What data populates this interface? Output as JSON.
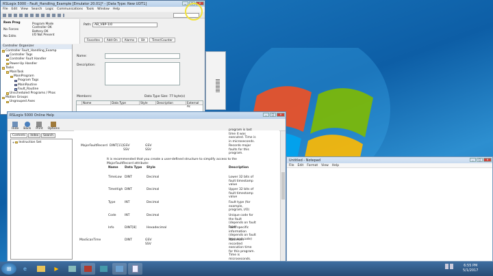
{
  "rslogix": {
    "title": "RSLogix 5000 - Fault_Handling_Example [Emulator 20.01]* - [Data Type: New UDT1]",
    "menu": [
      "File",
      "Edit",
      "View",
      "Search",
      "Logic",
      "Communications",
      "Tools",
      "Window",
      "Help"
    ],
    "mode": {
      "state": "Rem Prog",
      "forces": "No Forces",
      "edits": "No Edits",
      "prog_mode": "Program Mode",
      "controller_ok": "Controller OK",
      "battery_ok": "Battery OK",
      "io": "I/O Not Present"
    },
    "path_label": "Path:",
    "path_value": "AB_VBP-1\\0",
    "tabs": [
      "Favorites",
      "Add-On",
      "Alarms",
      "Bit",
      "Timer/Counter"
    ],
    "organizer_title": "Controller Organizer",
    "tree": [
      {
        "label": "Controller Fault_Handling_Examp",
        "level": 0,
        "icon": "fold"
      },
      {
        "label": "Controller Tags",
        "level": 1,
        "icon": "tag"
      },
      {
        "label": "Controller Fault Handler",
        "level": 1,
        "icon": "fold"
      },
      {
        "label": "Power-Up Handler",
        "level": 1,
        "icon": "fold"
      },
      {
        "label": "Tasks",
        "level": 0,
        "icon": "fold"
      },
      {
        "label": "MainTask",
        "level": 1,
        "icon": "fold"
      },
      {
        "label": "MainProgram",
        "level": 2,
        "icon": "fold"
      },
      {
        "label": "Program Tags",
        "level": 3,
        "icon": "tag"
      },
      {
        "label": "MainRoutine",
        "level": 3,
        "icon": "tag"
      },
      {
        "label": "Fault_Routine",
        "level": 3,
        "icon": "tag"
      },
      {
        "label": "Unscheduled Programs / Phas",
        "level": 1,
        "icon": "fold"
      },
      {
        "label": "Motion Groups",
        "level": 0,
        "icon": "fold"
      },
      {
        "label": "Ungrouped Axes",
        "level": 1,
        "icon": "fold"
      }
    ],
    "udt": {
      "name_label": "Name:",
      "desc_label": "Description:",
      "members_label": "Members:",
      "size_label": "Data Type Size: 77 byte(s)",
      "cols": [
        "Name",
        "Data Type",
        "Style",
        "Description",
        "External Ac"
      ]
    }
  },
  "help": {
    "title": "RSLogix 5000 Online Help",
    "toolbar": [
      "Hide",
      "Back",
      "Print",
      "Options"
    ],
    "tabs": [
      "Contents",
      "Index",
      "Search"
    ],
    "tree_item": "Instruction Set",
    "top_rows": [
      {
        "label": "",
        "col2": "",
        "col3": "",
        "desc": "program is last"
      },
      {
        "label": "",
        "col2": "",
        "col3": "",
        "desc": "time it was"
      },
      {
        "label": "",
        "col2": "",
        "col3": "",
        "desc": "executed. Time is"
      },
      {
        "label": "",
        "col2": "",
        "col3": "",
        "desc": "in microseconds."
      }
    ],
    "major": {
      "name": "MajorFaultRecord",
      "type": "DINT[11]",
      "gsv": "GSV",
      "ssv": "SSV",
      "desc": [
        "Records major",
        "faults for this",
        "program."
      ]
    },
    "recommend": [
      "It is recommended that you create a user-defined structure to simplify access to the",
      "MajorFaultRecord attribute:"
    ],
    "cols": [
      "Name",
      "Data Type",
      "Style",
      "Description"
    ],
    "rows": [
      {
        "name": "TimeLow",
        "type": "DINT",
        "style": "Decimal",
        "desc": [
          "Lower 32 bits of",
          "fault timestamp",
          "value"
        ]
      },
      {
        "name": "TimeHigh",
        "type": "DINT",
        "style": "Decimal",
        "desc": [
          "Upper 32 bits of",
          "fault timestamp",
          "value"
        ]
      },
      {
        "name": "Type",
        "type": "INT",
        "style": "Decimal",
        "desc": [
          "Fault type (for",
          "example,",
          "program, I/O)"
        ]
      },
      {
        "name": "Code",
        "type": "INT",
        "style": "Decimal",
        "desc": [
          "Unique code for",
          "the fault",
          "(depends on fault",
          "type)"
        ]
      },
      {
        "name": "Info",
        "type": "DINT[8]",
        "style": "Hexadecimal",
        "desc": [
          "Fault specific",
          "information",
          "(depends on fault",
          "type and code)"
        ]
      }
    ],
    "maxscan": {
      "name": "MaxScanTime",
      "type": "DINT",
      "gsv": "GSV",
      "ssv": "SSV",
      "desc": [
        "Maximum",
        "recorded",
        "execution time",
        "for this program.",
        "Time is",
        "microseconds."
      ]
    }
  },
  "notepad": {
    "title": "Untitled - Notepad",
    "menu": [
      "File",
      "Edit",
      "Format",
      "View",
      "Help"
    ]
  },
  "clock": {
    "time": "6:55 PM",
    "date": "5/1/2017"
  },
  "colors": {
    "wallpaper": "#0d5ea6",
    "taskbar": "#2a4d75",
    "win_frame": "#6b8fb5"
  }
}
